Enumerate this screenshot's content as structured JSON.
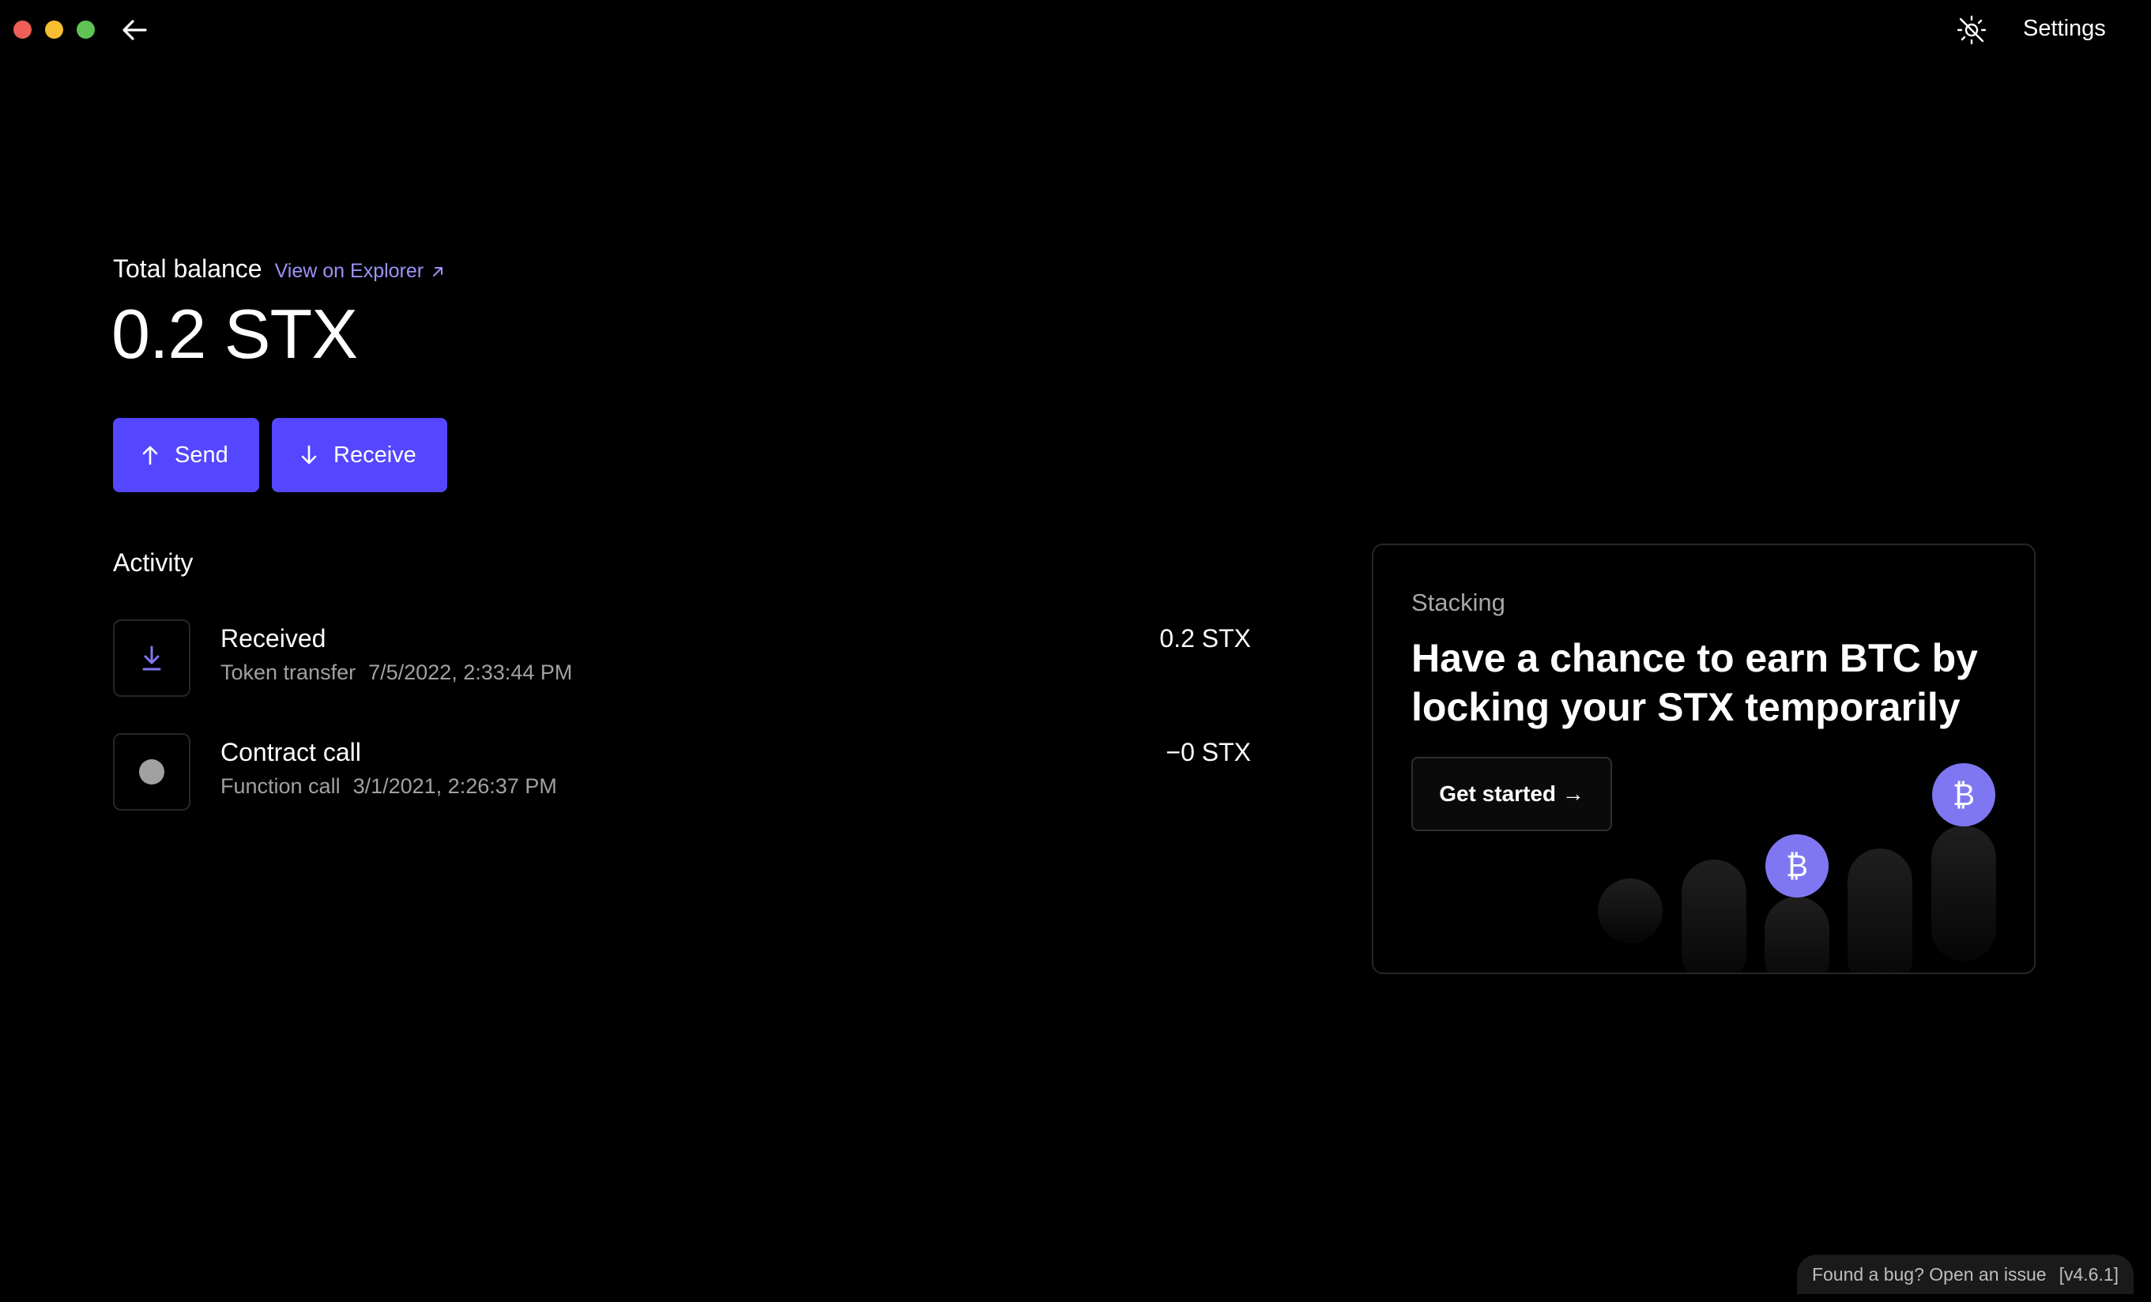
{
  "header": {
    "settings_label": "Settings",
    "back_icon": "arrow-left-icon",
    "theme_icon": "theme-toggle-icon"
  },
  "balance": {
    "label": "Total balance",
    "explorer_label": "View on Explorer",
    "value": "0.2 STX"
  },
  "actions": {
    "send_label": "Send",
    "receive_label": "Receive"
  },
  "activity": {
    "title": "Activity",
    "items": [
      {
        "title": "Received",
        "type": "Token transfer",
        "date": "7/5/2022, 2:33:44 PM",
        "amount": "0.2 STX",
        "icon": "download-icon"
      },
      {
        "title": "Contract call",
        "type": "Function call",
        "date": "3/1/2021, 2:26:37 PM",
        "amount": "−0 STX",
        "icon": "dot-icon"
      }
    ]
  },
  "stacking": {
    "label": "Stacking",
    "heading": "Have a chance to earn BTC by locking your STX temporarily",
    "cta_label": "Get started →",
    "btc_symbol": "₿"
  },
  "footer": {
    "bug_text": "Found a bug? Open an issue",
    "version": "[v4.6.1]"
  },
  "colors": {
    "accent": "#5546ff",
    "link": "#9c93f5",
    "btc_badge": "#7f77f1"
  }
}
